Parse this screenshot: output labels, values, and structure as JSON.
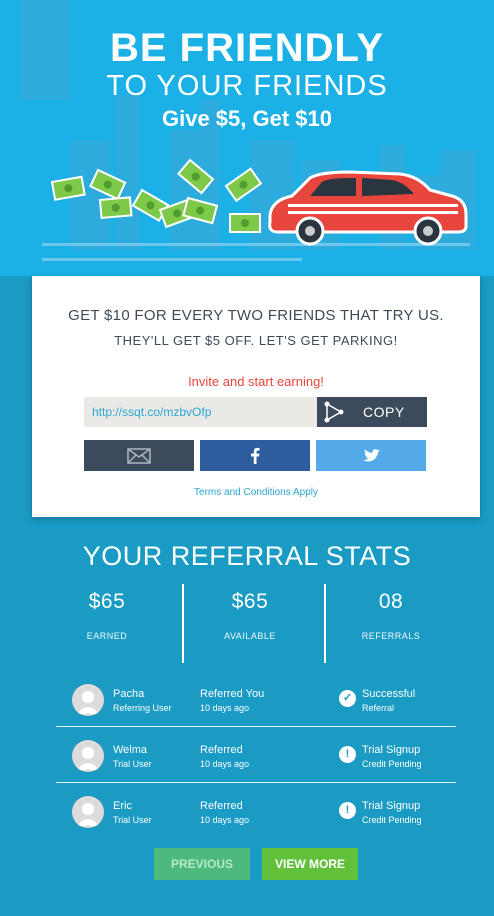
{
  "hero": {
    "title_line1": "BE FRIENDLY",
    "title_line2": "TO YOUR FRIENDS",
    "title_line3": "Give $5, Get $10"
  },
  "card": {
    "headline": "GET $10 FOR EVERY TWO FRIENDS THAT TRY US.",
    "subline": "THEY'LL GET $5 OFF. LET'S GET PARKING!",
    "invite_text": "Invite and start earning!",
    "referral_link": "http://ssqt.co/mzbvOfp",
    "copy_label": "COPY",
    "share_icons": [
      "mail-icon",
      "facebook-icon",
      "twitter-icon"
    ],
    "terms_label": "Terms and Conditions Apply"
  },
  "stats": {
    "title": "YOUR REFERRAL STATS",
    "items": [
      {
        "value": "$65",
        "label": "EARNED"
      },
      {
        "value": "$65",
        "label": "AVAILABLE"
      },
      {
        "value": "08",
        "label": "REFERRALS"
      }
    ]
  },
  "referrals": [
    {
      "name": "Pacha",
      "role": "Referring User",
      "action": "Referred You",
      "time": "10 days ago",
      "status_icon": "check-icon",
      "status": "Successful",
      "substatus": "Referral"
    },
    {
      "name": "Welma",
      "role": "Trial User",
      "action": "Referred",
      "time": "10 days ago",
      "status_icon": "alert-icon",
      "status": "Trial Signup",
      "substatus": "Credit Pending"
    },
    {
      "name": "Eric",
      "role": "Trial User",
      "action": "Referred",
      "time": "10 days ago",
      "status_icon": "alert-icon",
      "status": "Trial Signup",
      "substatus": "Credit Pending"
    }
  ],
  "pager": {
    "previous_label": "PREVIOUS",
    "more_label": "VIEW MORE"
  },
  "colors": {
    "hero_bg": "#1bb1e6",
    "page_bg": "#1a9bc4",
    "invite_red": "#e8463d",
    "copy_dark": "#3c4b5b",
    "facebook": "#2d5d9e",
    "twitter": "#54a9e8",
    "prev_green": "#4db97d",
    "more_green": "#62c13b"
  }
}
